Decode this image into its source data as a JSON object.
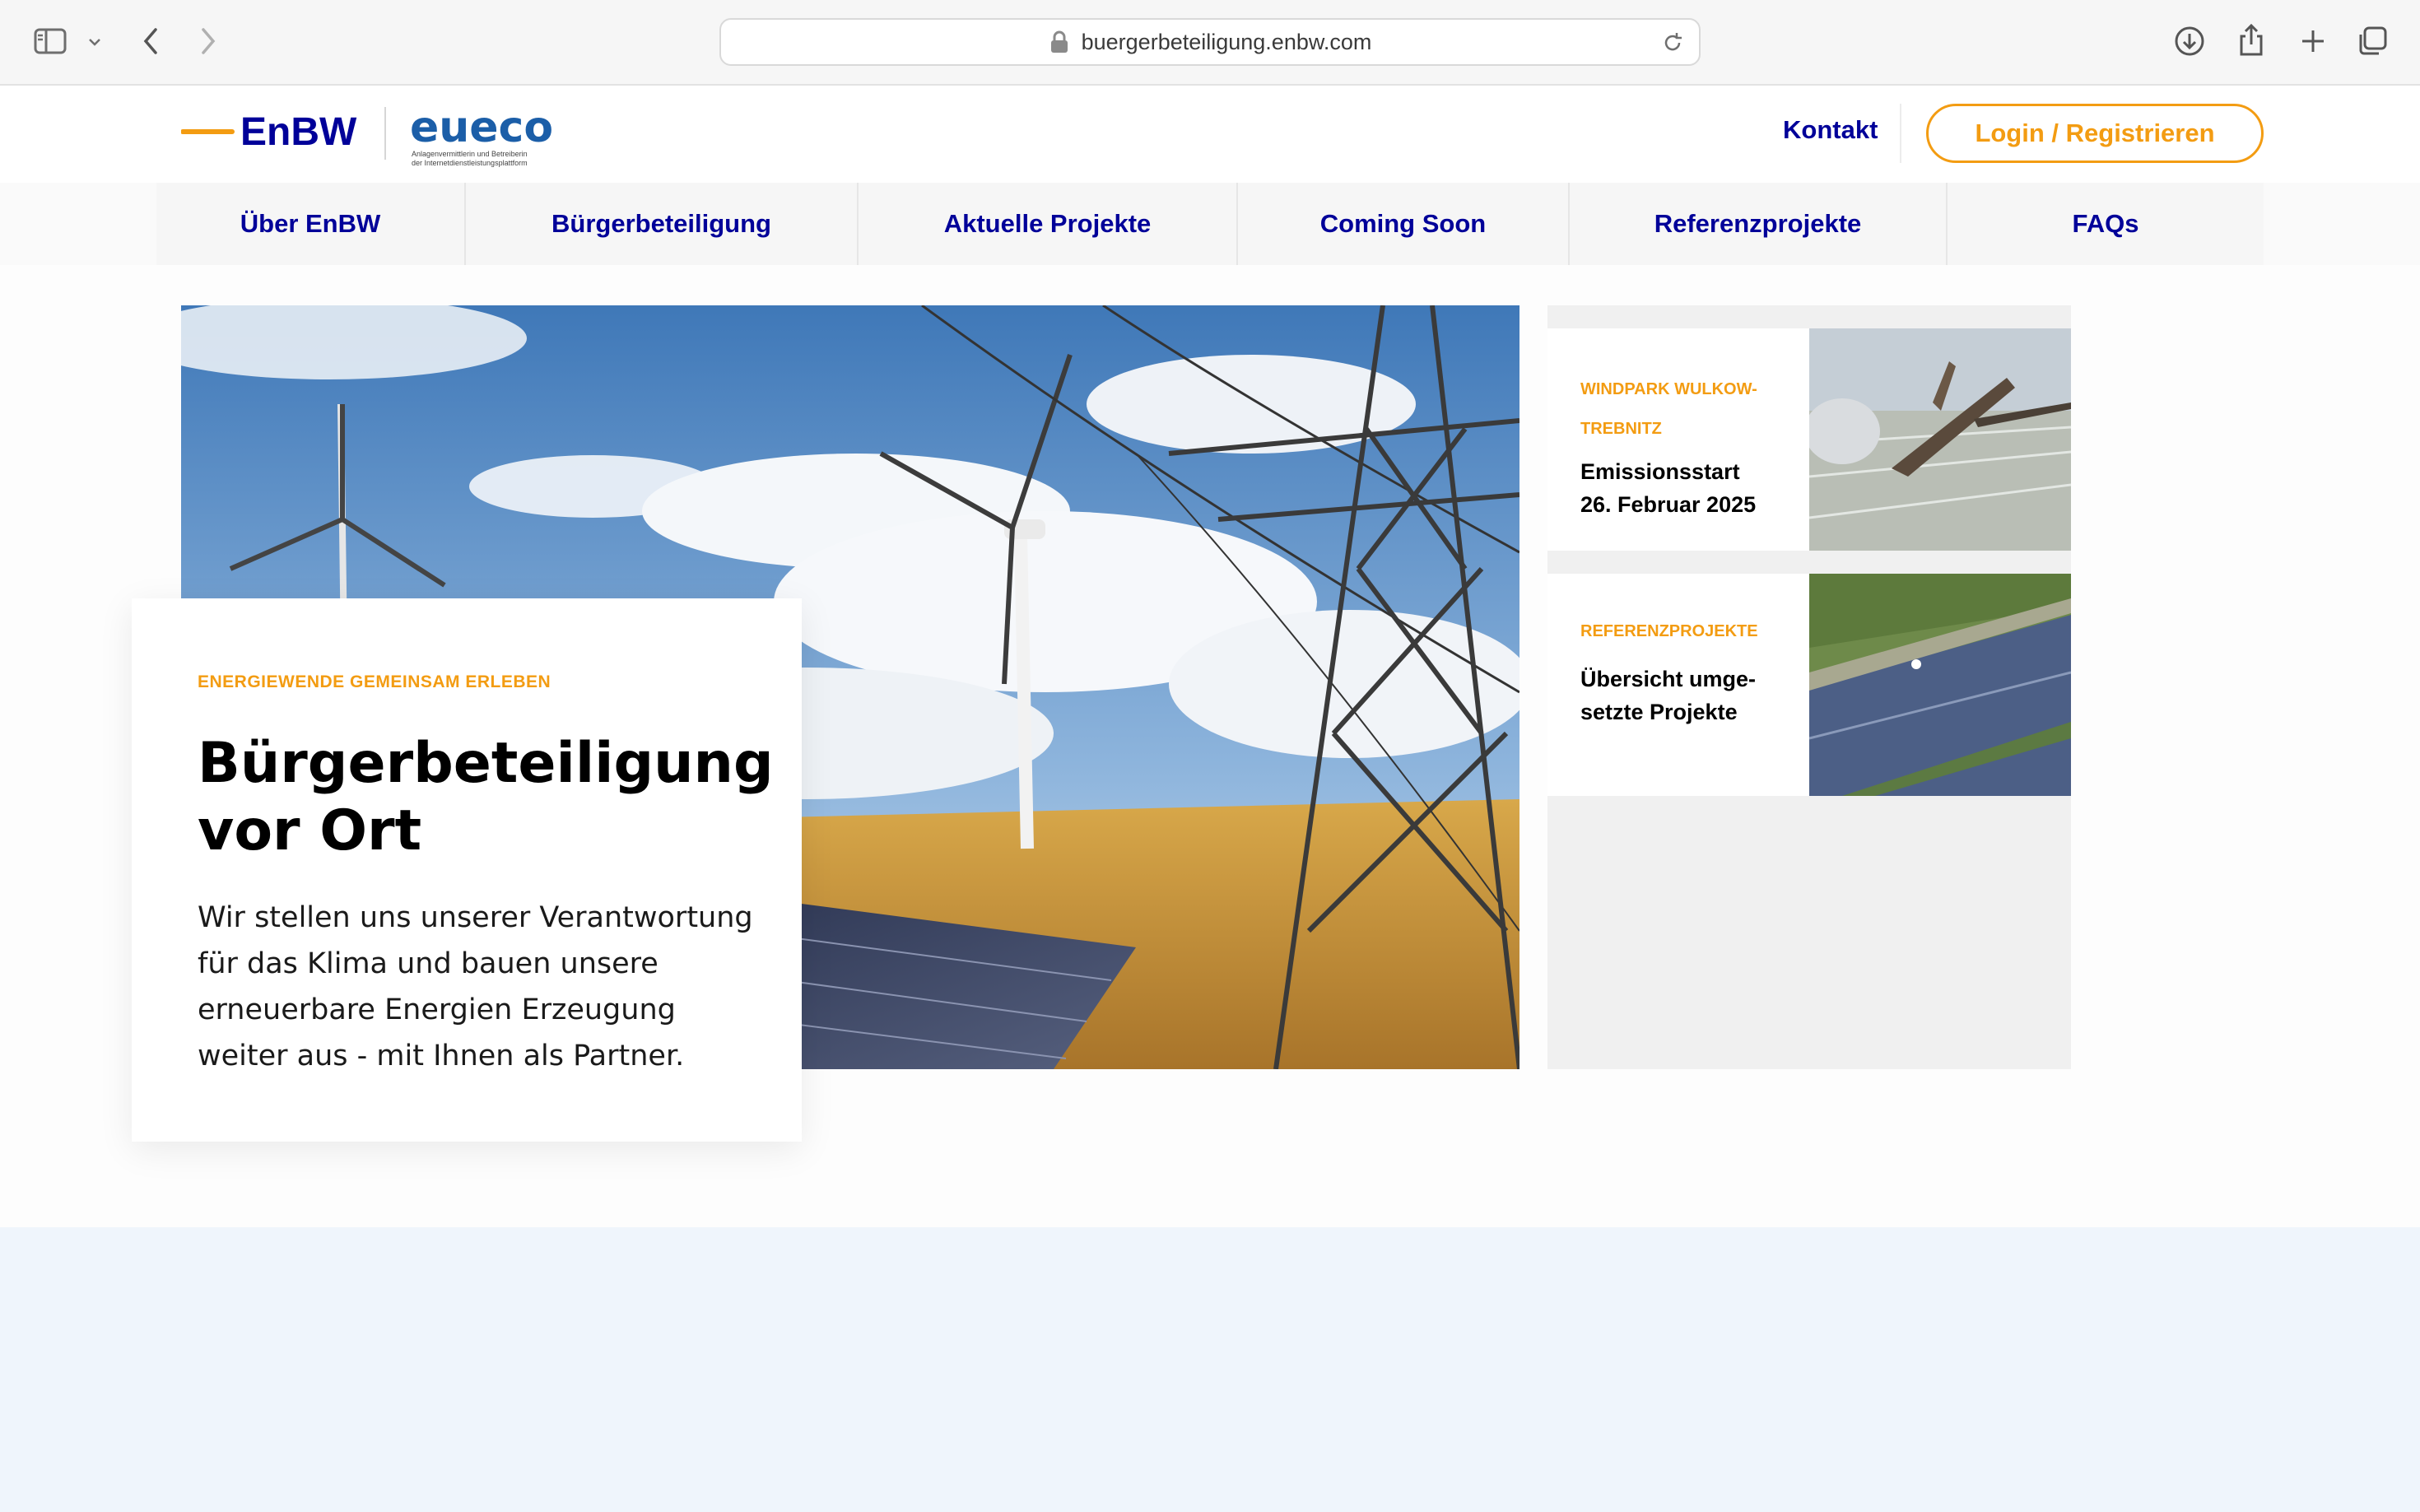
{
  "browser": {
    "url": "buergerbeteiligung.enbw.com"
  },
  "header": {
    "logo_enbw": "EnBW",
    "logo_eueco": "eueco",
    "logo_eueco_tagline_1": "Anlagenvermittlerin und Betreiberin",
    "logo_eueco_tagline_2": "der Internetdienstleistungsplattform",
    "kontakt": "Kontakt",
    "login": "Login / Registrieren"
  },
  "nav": {
    "items": [
      {
        "label": "Über EnBW"
      },
      {
        "label": "Bürgerbeteiligung"
      },
      {
        "label": "Aktuelle Projekte"
      },
      {
        "label": "Coming Soon"
      },
      {
        "label": "Referenzprojekte"
      },
      {
        "label": "FAQs"
      }
    ]
  },
  "hero": {
    "eyebrow": "ENERGIEWENDE GEMEINSAM ERLEBEN",
    "title_line1": "Bürgerbeteiligung",
    "title_line2": "vor Ort",
    "text": "Wir stellen uns unserer Verantwortung für das Klima und bauen unsere erneuerbare Energien Erzeugung weiter aus - mit Ihnen als Partner."
  },
  "side_cards": [
    {
      "eyebrow_line1": "WINDPARK WULKOW-",
      "eyebrow_line2": "TREBNITZ",
      "title_line1": "Emissionsstart",
      "title_line2": "26. Februar 2025"
    },
    {
      "eyebrow_line1": "REFERENZPROJEKTE",
      "title_line1": "Übersicht umge-",
      "title_line2": "setzte Projekte"
    }
  ],
  "colors": {
    "accent_orange": "#f39c12",
    "brand_blue": "#000099"
  }
}
